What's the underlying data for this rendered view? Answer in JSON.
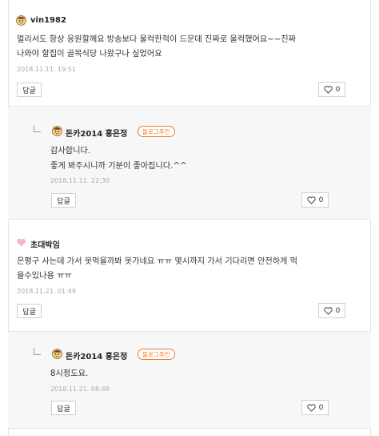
{
  "comments": [
    {
      "nickname": "vin1982",
      "avatar_icon": "cartoon-avatar-icon",
      "lines": [
        "멀리서도 항상 응원할께요 방송보다 울컥한적이 드문데 진짜로 울컥했어요~~진짜",
        "나와야 할집이 골목식당 나왔구나 싶었어요"
      ],
      "date": "2018.11.11. 19:51",
      "reply_label": "답글",
      "likes": "0"
    },
    {
      "nickname": "돈카2014 홍은정",
      "avatar_icon": "cartoon-avatar-icon",
      "badge": "블로그주인",
      "lines": [
        "감사합니다.",
        "좋게 봐주시니까 기분이 좋아집니다.^^"
      ],
      "date": "2018.11.11. 22:30",
      "reply_label": "답글",
      "likes": "0"
    },
    {
      "nickname": "초대박임",
      "avatar_icon": "pink-heart-icon",
      "lines": [
        "은평구 사는데 가서 못먹을까봐 못가네요 ㅠㅠ 몇시까지 가서 기다리면 안전하게 먹",
        "을수있나용 ㅠㅠ"
      ],
      "date": "2018.11.21. 01:49",
      "reply_label": "답글",
      "likes": "0"
    },
    {
      "nickname": "돈카2014 홍은정",
      "avatar_icon": "cartoon-avatar-icon",
      "badge": "블로그주인",
      "lines": [
        "8시정도요."
      ],
      "date": "2018.11.21. 08:48",
      "reply_label": "답글",
      "likes": "0"
    }
  ],
  "colors": {
    "accent": "#f07a2a",
    "reply_bg": "#f7f7f7",
    "border": "#e6e6e6"
  }
}
